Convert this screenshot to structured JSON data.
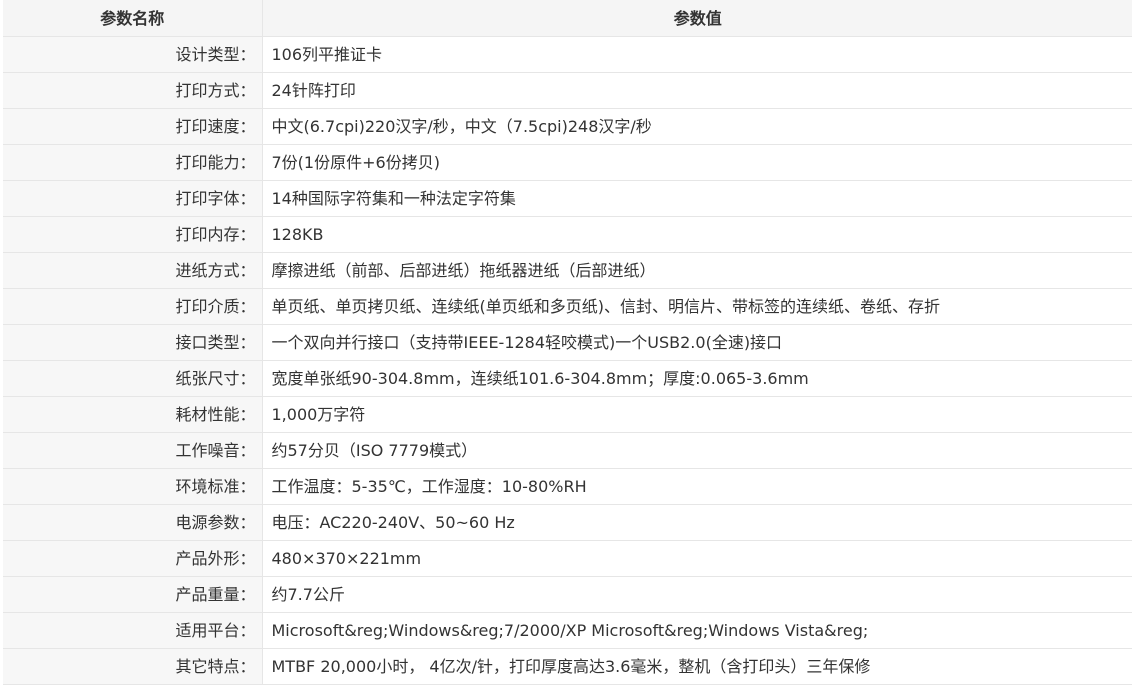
{
  "header": {
    "name_label": "参数名称",
    "value_label": "参数值"
  },
  "rows": [
    {
      "name": "设计类型：",
      "value": "106列平推证卡"
    },
    {
      "name": "打印方式：",
      "value": "24针阵打印"
    },
    {
      "name": "打印速度：",
      "value": "中文(6.7cpi)220汉字/秒，中文（7.5cpi)248汉字/秒"
    },
    {
      "name": "打印能力：",
      "value": "7份(1份原件+6份拷贝)"
    },
    {
      "name": "打印字体：",
      "value": "14种国际字符集和一种法定字符集"
    },
    {
      "name": "打印内存：",
      "value": "128KB"
    },
    {
      "name": "进纸方式：",
      "value": "摩擦进纸（前部、后部进纸）拖纸器进纸（后部进纸）"
    },
    {
      "name": "打印介质：",
      "value": "单页纸、单页拷贝纸、连续纸(单页纸和多页纸)、信封、明信片、带标签的连续纸、卷纸、存折"
    },
    {
      "name": "接口类型：",
      "value": "一个双向并行接口（支持带IEEE-1284轻咬模式)一个USB2.0(全速)接口"
    },
    {
      "name": "纸张尺寸：",
      "value": "宽度单张纸90-304.8mm，连续纸101.6-304.8mm；厚度:0.065-3.6mm"
    },
    {
      "name": "耗材性能：",
      "value": "1,000万字符"
    },
    {
      "name": "工作噪音：",
      "value": "约57分贝（ISO 7779模式）"
    },
    {
      "name": "环境标准：",
      "value": "工作温度：5-35℃，工作湿度：10-80%RH"
    },
    {
      "name": "电源参数：",
      "value": "电压：AC220-240V、50~60 Hz"
    },
    {
      "name": "产品外形：",
      "value": "480×370×221mm"
    },
    {
      "name": "产品重量：",
      "value": "约7.7公斤"
    },
    {
      "name": "适用平台：",
      "value": "Microsoft&reg;Windows&reg;7/2000/XP Microsoft&reg;Windows Vista&reg;"
    },
    {
      "name": "其它特点：",
      "value": "MTBF 20,000小时， 4亿次/针，打印厚度高达3.6毫米，整机（含打印头）三年保修"
    }
  ]
}
